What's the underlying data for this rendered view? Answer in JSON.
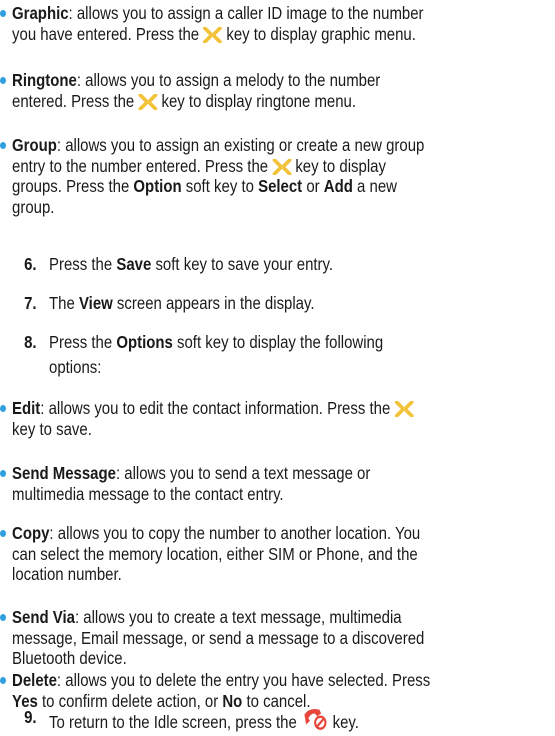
{
  "bullets_top": [
    {
      "term": "Graphic",
      "lines": [
        [
          ": allows you to assign a caller ID image to the number"
        ],
        [
          "you have entered. Press the ",
          {
            "icon": "navigation-key"
          },
          " key to display graphic menu."
        ]
      ]
    },
    {
      "term": "Ringtone",
      "lines": [
        [
          ": allows you to assign a melody to the number"
        ],
        [
          "entered. Press the ",
          {
            "icon": "navigation-key"
          },
          " key to display ringtone menu."
        ]
      ]
    },
    {
      "term": "Group",
      "lines": [
        [
          ": allows you to assign an existing or create a new group"
        ],
        [
          "entry to the number entered. Press the ",
          {
            "icon": "navigation-key"
          },
          " key to display"
        ],
        [
          "groups. Press the ",
          {
            "b": "Option"
          },
          " soft key to ",
          {
            "b": "Select"
          },
          " or ",
          {
            "b": "Add"
          },
          " a new"
        ],
        [
          "group."
        ]
      ]
    }
  ],
  "steps": [
    {
      "num": "6.",
      "lines": [
        [
          "Press the ",
          {
            "b": "Save"
          },
          " soft key to save your entry."
        ]
      ]
    },
    {
      "num": "7.",
      "lines": [
        [
          "The ",
          {
            "b": "View"
          },
          " screen appears in the display."
        ]
      ]
    },
    {
      "num": "8.",
      "lines": [
        [
          "Press the ",
          {
            "b": "Options"
          },
          " soft key to display the following"
        ],
        [
          "options:"
        ]
      ]
    }
  ],
  "bullets_bottom": [
    {
      "term": "Edit",
      "lines": [
        [
          ": allows you to edit the contact information. Press the ",
          {
            "icon": "navigation-key"
          }
        ],
        [
          "key to save."
        ]
      ]
    },
    {
      "term": "Send Message",
      "lines": [
        [
          ": allows you to send a text message or"
        ],
        [
          "multimedia message to the contact entry."
        ]
      ]
    },
    {
      "term": "Copy",
      "lines": [
        [
          ": allows you to copy the number to another location. You"
        ],
        [
          "can select the memory location, either SIM or Phone, and the"
        ],
        [
          "location number."
        ]
      ]
    },
    {
      "term": "Send Via",
      "lines": [
        [
          ": allows you to create a text message, multimedia"
        ],
        [
          "message, Email message, or send a message to a discovered"
        ],
        [
          "Bluetooth device."
        ]
      ]
    },
    {
      "term": "Delete",
      "lines": [
        [
          ": allows you to delete the entry you have selected. Press"
        ],
        [
          {
            "b": "Yes"
          },
          " to confirm delete action, or ",
          {
            "b": "No"
          },
          " to cancel."
        ]
      ]
    }
  ],
  "final_step": {
    "num": "9.",
    "lines": [
      [
        "To return to the Idle screen, press the ",
        {
          "icon": "end-key"
        },
        " key."
      ]
    ]
  },
  "colors": {
    "bullet": "#2f9fe0",
    "nav_key": "#f2c23a",
    "end_key_bg": "#e8463a",
    "text": "#1a1a1a"
  }
}
